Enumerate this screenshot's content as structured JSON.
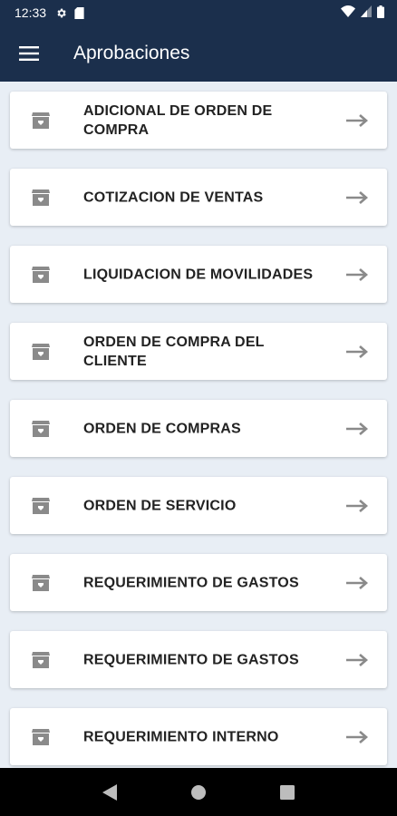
{
  "status_bar": {
    "time": "12:33",
    "icons": [
      "gear-icon",
      "sd-card-icon",
      "wifi-icon",
      "signal-icon",
      "battery-icon"
    ]
  },
  "app_bar": {
    "title": "Aprobaciones",
    "menu_icon": "hamburger-menu-icon"
  },
  "approvals": [
    {
      "label": "ADICIONAL DE ORDEN DE COMPRA"
    },
    {
      "label": "COTIZACION DE VENTAS"
    },
    {
      "label": "LIQUIDACION DE MOVILIDADES"
    },
    {
      "label": "ORDEN DE COMPRA DEL CLIENTE"
    },
    {
      "label": "ORDEN DE COMPRAS"
    },
    {
      "label": "ORDEN DE SERVICIO"
    },
    {
      "label": "REQUERIMIENTO DE GASTOS"
    },
    {
      "label": "REQUERIMIENTO DE GASTOS"
    },
    {
      "label": "REQUERIMIENTO INTERNO"
    }
  ],
  "item_icon": "archive-box-icon",
  "item_arrow_icon": "arrow-right-icon",
  "nav_bar": {
    "buttons": [
      "back-icon",
      "home-icon",
      "recents-icon"
    ]
  },
  "colors": {
    "primary": "#1b2f4c",
    "background": "#e8eef5",
    "card": "#ffffff",
    "icon_gray": "#8a8a8a"
  }
}
